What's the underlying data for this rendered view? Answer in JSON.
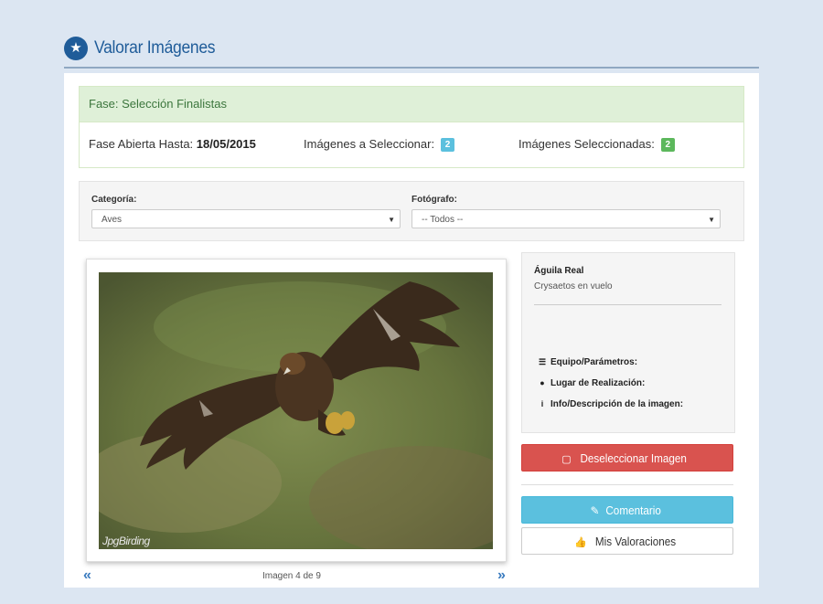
{
  "header": {
    "title": "Valorar Imágenes",
    "icon": "star-icon"
  },
  "phase": {
    "title": "Fase: Selección Finalistas",
    "open_until_label": "Fase Abierta Hasta:",
    "open_until_value": "18/05/2015",
    "to_select_label": "Imágenes a Seleccionar:",
    "to_select_count": "2",
    "selected_label": "Imágenes Seleccionadas:",
    "selected_count": "2",
    "colors": {
      "to_select_badge": "#5bc0de",
      "selected_badge": "#5cb85c"
    }
  },
  "filters": {
    "category_label": "Categoría:",
    "category_value": "Aves",
    "photographer_label": "Fotógrafo:",
    "photographer_value": "-- Todos --"
  },
  "image": {
    "watermark": "JpgBirding",
    "counter": "Imagen 4 de 9",
    "prev_icon": "«",
    "next_icon": "»"
  },
  "info": {
    "title": "Águila Real",
    "subtitle": "Crysaetos en vuelo",
    "equipment_label": "Equipo/Parámetros:",
    "location_label": "Lugar de Realización:",
    "description_label": "Info/Descripción de la imagen:"
  },
  "buttons": {
    "deselect": "Deseleccionar Imagen",
    "comment": "Comentario",
    "ratings": "Mis Valoraciones",
    "colors": {
      "deselect": "#d9534f",
      "comment": "#5bc0de"
    }
  }
}
